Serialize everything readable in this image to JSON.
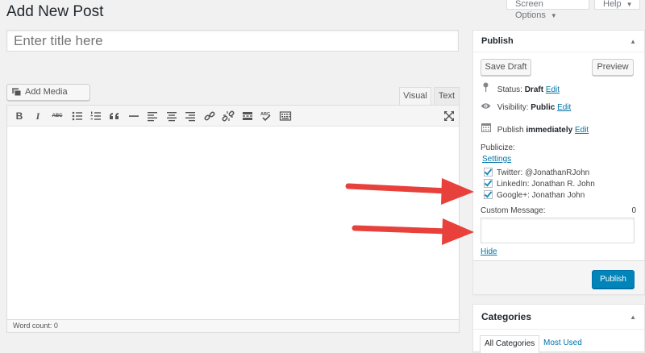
{
  "header": {
    "screen_options_label": "Screen Options",
    "help_label": "Help",
    "page_title": "Add New Post"
  },
  "title_field": {
    "placeholder": "Enter title here",
    "value": ""
  },
  "editor": {
    "add_media_label": "Add Media",
    "tabs": [
      "Visual",
      "Text"
    ],
    "active_tab": "Visual",
    "toolbar_icons": [
      "bold-icon",
      "italic-icon",
      "strikethrough-icon",
      "bullet-list-icon",
      "numbered-list-icon",
      "blockquote-icon",
      "horizontal-line-icon",
      "align-left-icon",
      "align-center-icon",
      "align-right-icon",
      "link-icon",
      "unlink-icon",
      "read-more-icon",
      "spellcheck-icon",
      "toolbar-toggle-icon",
      "fullscreen-icon"
    ],
    "toolbar_glyphs": {
      "bold": "B",
      "italic": "I",
      "strike": "ABC"
    },
    "word_count_label": "Word count: 0"
  },
  "publish_box": {
    "title": "Publish",
    "save_draft_label": "Save Draft",
    "preview_label": "Preview",
    "status_label": "Status:",
    "status_value": "Draft",
    "visibility_label": "Visibility:",
    "visibility_value": "Public",
    "publish_label": "Publish",
    "publish_when": "immediately",
    "edit_label": "Edit",
    "publicize_label": "Publicize:",
    "settings_label": "Settings",
    "accounts": [
      {
        "label": "Twitter: @JonathanRJohn",
        "checked": true
      },
      {
        "label": "LinkedIn: Jonathan R. John",
        "checked": true
      },
      {
        "label": "Google+: Jonathan John",
        "checked": true
      }
    ],
    "custom_message_label": "Custom Message:",
    "custom_message_count": "0",
    "custom_message_value": "",
    "hide_label": "Hide",
    "publish_button_label": "Publish"
  },
  "categories_box": {
    "title": "Categories",
    "tabs": [
      "All Categories",
      "Most Used"
    ]
  },
  "colors": {
    "accent": "#0073aa",
    "primary_button": "#0085ba",
    "arrow": "#e8413c"
  }
}
